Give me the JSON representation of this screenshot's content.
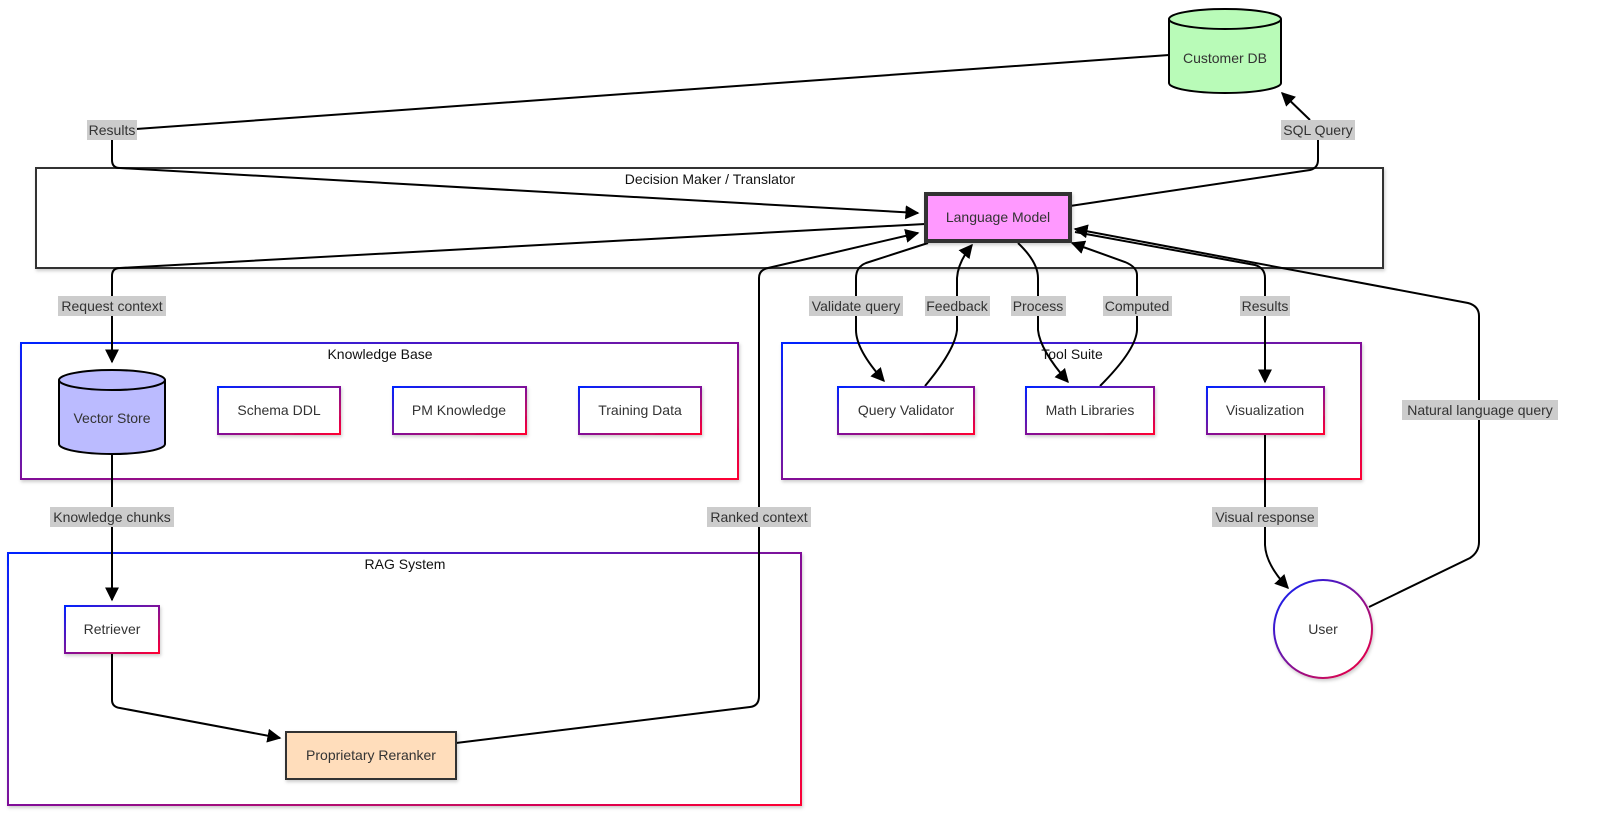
{
  "groups": {
    "decision": {
      "title": "Decision Maker / Translator"
    },
    "knowledge": {
      "title": "Knowledge Base"
    },
    "tools": {
      "title": "Tool Suite"
    },
    "rag": {
      "title": "RAG System"
    }
  },
  "nodes": {
    "customer_db": {
      "label": "Customer DB",
      "color": "#b9fbb8"
    },
    "language_model": {
      "label": "Language Model",
      "color": "#ff99ff"
    },
    "vector_store": {
      "label": "Vector Store",
      "color": "#bbbbff"
    },
    "schema_ddl": {
      "label": "Schema DDL"
    },
    "pm_knowledge": {
      "label": "PM Knowledge"
    },
    "training_data": {
      "label": "Training Data"
    },
    "query_validator": {
      "label": "Query Validator"
    },
    "math_libraries": {
      "label": "Math Libraries"
    },
    "visualization": {
      "label": "Visualization"
    },
    "retriever": {
      "label": "Retriever"
    },
    "reranker": {
      "label": "Proprietary Reranker",
      "color": "#ffddbb"
    },
    "user": {
      "label": "User"
    }
  },
  "edges": {
    "results_db": "Results",
    "sql_query": "SQL Query",
    "request_context": "Request context",
    "validate_query": "Validate query",
    "feedback": "Feedback",
    "process": "Process",
    "computed": "Computed",
    "results_viz": "Results",
    "natural_language_query": "Natural language query",
    "knowledge_chunks": "Knowledge chunks",
    "ranked_context": "Ranked context",
    "visual_response": "Visual response"
  },
  "colors": {
    "gradient_start": "#0022ff",
    "gradient_end": "#ff0033",
    "edge_label_bg": "#cccccc"
  }
}
